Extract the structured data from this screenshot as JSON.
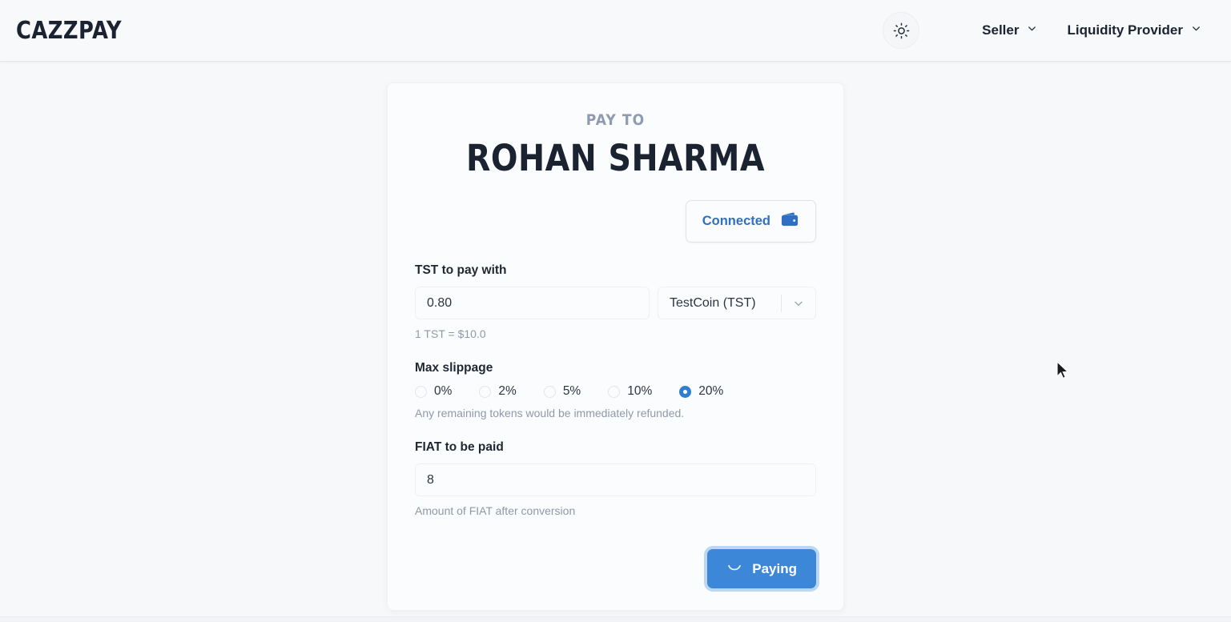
{
  "header": {
    "logo": "CAZZPAY",
    "theme_toggle_icon": "sun-icon",
    "nav": [
      {
        "label": "Seller",
        "icon": "chevron-down-icon"
      },
      {
        "label": "Liquidity Provider",
        "icon": "chevron-down-icon"
      }
    ]
  },
  "card": {
    "pay_to_label": "PAY TO",
    "payee_name": "ROHAN SHARMA",
    "wallet": {
      "status_label": "Connected",
      "icon": "wallet-icon"
    },
    "token_field": {
      "label": "TST to pay with",
      "value": "0.80",
      "placeholder": "0.00",
      "select_value": "TestCoin (TST)",
      "select_icon": "chevron-down-icon",
      "helper": "1 TST = $10.0"
    },
    "slippage": {
      "label": "Max slippage",
      "options": [
        {
          "label": "0%",
          "selected": false
        },
        {
          "label": "2%",
          "selected": false
        },
        {
          "label": "5%",
          "selected": false
        },
        {
          "label": "10%",
          "selected": false
        },
        {
          "label": "20%",
          "selected": true
        }
      ],
      "helper": "Any remaining tokens would be immediately refunded."
    },
    "fiat_field": {
      "label": "FIAT to be paid",
      "value": "8",
      "placeholder": "0",
      "helper": "Amount of FIAT after conversion"
    },
    "submit": {
      "label": "Paying",
      "icon": "spinner-icon"
    }
  },
  "colors": {
    "accent_blue": "#3c87d8",
    "link_blue": "#2f6fc4",
    "page_bg": "#f7f8fa",
    "text_dark": "#1b2230",
    "muted": "#8f99a8"
  }
}
